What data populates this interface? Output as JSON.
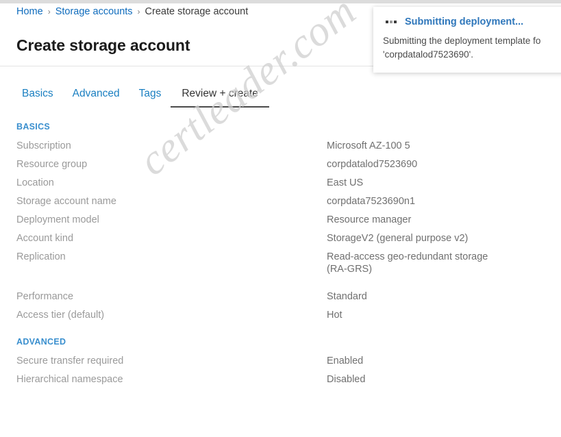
{
  "breadcrumb": {
    "items": [
      {
        "label": "Home",
        "link": true
      },
      {
        "label": "Storage accounts",
        "link": true
      },
      {
        "label": "Create storage account",
        "link": false
      }
    ],
    "separator": "›"
  },
  "page": {
    "title": "Create storage account"
  },
  "tabs": [
    {
      "label": "Basics",
      "active": false
    },
    {
      "label": "Advanced",
      "active": false
    },
    {
      "label": "Tags",
      "active": false
    },
    {
      "label": "Review + create",
      "active": true
    }
  ],
  "sections": [
    {
      "heading": "BASICS",
      "rows": [
        {
          "label": "Subscription",
          "value": "Microsoft AZ-100 5"
        },
        {
          "label": "Resource group",
          "value": "corpdatalod7523690"
        },
        {
          "label": "Location",
          "value": "East US"
        },
        {
          "label": "Storage account name",
          "value": "corpdata7523690n1"
        },
        {
          "label": "Deployment model",
          "value": "Resource manager"
        },
        {
          "label": "Account kind",
          "value": "StorageV2 (general purpose v2)"
        },
        {
          "label": "Replication",
          "value": "Read-access geo-redundant storage (RA-GRS)"
        },
        {
          "label": "",
          "value": "",
          "spacer": true
        },
        {
          "label": "Performance",
          "value": "Standard"
        },
        {
          "label": "Access tier (default)",
          "value": "Hot"
        }
      ]
    },
    {
      "heading": "ADVANCED",
      "rows": [
        {
          "label": "Secure transfer required",
          "value": "Enabled"
        },
        {
          "label": "Hierarchical namespace",
          "value": "Disabled"
        }
      ]
    }
  ],
  "notification": {
    "icon": "progress-dots-icon",
    "title": "Submitting deployment...",
    "body_line_1": "Submitting the deployment template fo",
    "body_line_2": "'corpdatalod7523690'."
  },
  "watermark": {
    "text": "certleader.com"
  },
  "colors": {
    "link_blue": "#0f6cbd",
    "tab_blue": "#1a7fc1",
    "section_heading_blue": "#3a8fce",
    "notify_title_blue": "#2f77bb",
    "label_gray": "#9a9a9a",
    "value_gray": "#707070"
  }
}
